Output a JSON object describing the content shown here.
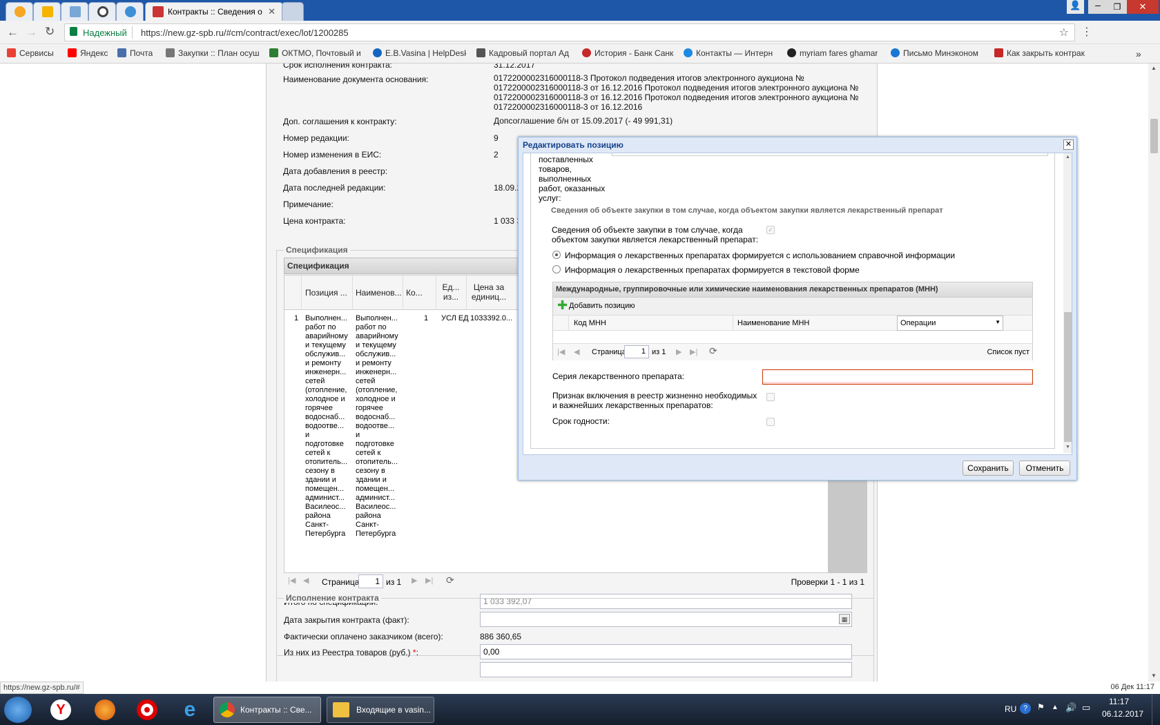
{
  "browser": {
    "active_tab_title": "Контракты :: Сведения о",
    "secure_label": "Надежный",
    "url": "https://new.gz-spb.ru/#cm/contract/exec/lot/1200285",
    "status_url": "https://new.gz-spb.ru/#",
    "status_date": "06 Дек 11:17"
  },
  "bookmarks": [
    {
      "label": "Сервисы",
      "color": "#e94235"
    },
    {
      "label": "Яндекс",
      "color": "#ff0000"
    },
    {
      "label": "Почта",
      "color": "#4a6ea9"
    },
    {
      "label": "Закупки :: План осуш",
      "color": "#777777"
    },
    {
      "label": "ОКТМО, Почтовый и",
      "color": "#2e7d32"
    },
    {
      "label": "E.B.Vasina | HelpDesk",
      "color": "#1565c0"
    },
    {
      "label": "Кадровый портал Ад",
      "color": "#555555"
    },
    {
      "label": "История - Банк Санк",
      "color": "#c62828"
    },
    {
      "label": "Контакты — Интерн",
      "color": "#1e88e5"
    },
    {
      "label": "myriam fares ghamar",
      "color": "#222222"
    },
    {
      "label": "Письмо Минэконом",
      "color": "#1976d2"
    },
    {
      "label": "Как закрыть контрак",
      "color": "#c62828"
    }
  ],
  "contract": {
    "row0_label": "Срок исполнения контракта:",
    "row0_value": "31.12.2017",
    "basis_label": "Наименование документа основания:",
    "basis_value": "0172200002316000118-3 Протокол подведения итогов электронного аукциона №\n0172200002316000118-3 от 16.12.2016 Протокол подведения итогов электронного аукциона №\n0172200002316000118-3 от 16.12.2016 Протокол подведения итогов электронного аукциона №\n0172200002316000118-3 от 16.12.2016",
    "addl_label": "Доп. соглашения к контракту:",
    "addl_value": "Допсоглашение б/н от 15.09.2017 (- 49 991,31)",
    "edition_label": "Номер редакции:",
    "edition_value": "9",
    "eis_label": "Номер изменения в ЕИС:",
    "eis_value": "2",
    "added_label": "Дата добавления в реестр:",
    "lastedit_label": "Дата последней редакции:",
    "lastedit_value": "18.09.2",
    "note_label": "Примечание:",
    "price_label": "Цена контракта:",
    "price_value": "1 033 3"
  },
  "spec": {
    "legend": "Спецификация",
    "panel_title": "Спецификация",
    "columns": [
      "Позиция ...",
      "Наименов...",
      "Ко...",
      "Ед... из...",
      "Цена за единиц..."
    ],
    "row_num": "1",
    "row_pos": "Выполнен...\nработ по\nаварийному\nи текущему\nобслужив...\nи ремонту\nинженерн...\nсетей\n(отопление,\nхолодное и\nгорячее\nводоснаб...\nводоотве...\nи\nподготовке\nсетей к\nотопитель...\nсезону в\nздании и\nпомещен...\nадминист...\nВасилеос...\nрайона\nСанкт-\nПетербурга",
    "row_name": "Выполнен...\nработ по\nаварийному\nи текущему\nобслужив...\nи ремонту\nинженерн...\nсетей\n(отопление,\nхолодное и\nгорячее\nводоснаб...\nводоотве...\nи\nподготовке\nсетей к\nотопитель...\nсезону в\nздании и\nпомещен...\nадминист...\nВасилеос...\nрайона\nСанкт-\nПетербурга",
    "row_qty": "1",
    "row_unit": "УСЛ ЕД",
    "row_price": "1033392.0...",
    "page_label": "Страница",
    "page_num": "1",
    "page_of": "из 1",
    "checks": "Проверки 1 - 1 из 1",
    "total_label": "Итого по спецификации:",
    "total_value": "1 033 392,07"
  },
  "execution": {
    "legend": "Исполнение контракта",
    "close_label": "Дата закрытия контракта (факт):",
    "paid_label": "Фактически оплачено заказчиком (всего):",
    "paid_value": "886 360,65",
    "registry_label": "Из них из Реестра товаров (руб.)",
    "registry_star": "*",
    "registry_colon": ":",
    "registry_value": "0,00"
  },
  "dialog": {
    "title": "Редактировать позицию",
    "wrapped_label": "поставленных\nтоваров,\nвыполненных\nработ, оказанных\nуслуг:",
    "section_title": "Сведения об объекте закупки в том случае, когда объектом закупки является лекарственный препарат",
    "drug_label": "Сведения об объекте закупки в том случае, когда\nобъектом закупки является лекарственный препарат:",
    "radio1": "Информация о лекарственных препаратах формируется с использованием справочной информации",
    "radio2": "Информация о лекарственных препаратах формируется в текстовой форме",
    "mnn_title": "Международные, группировочные или химические наименования лекарственных препаратов (МНН)",
    "add_label": "Добавить позицию",
    "col_code": "Код МНН",
    "col_name": "Наименование МНН",
    "col_ops": "Операции",
    "page_label": "Страница",
    "page_num": "1",
    "page_of": "из 1",
    "empty": "Список пуст",
    "series_label": "Серия лекарственного препарата:",
    "registry_label": "Признак включения в реестр жизненно необходимых\nи важнейших лекарственных препаратов:",
    "expiry_label": "Срок годности:",
    "save": "Сохранить",
    "cancel": "Отменить"
  },
  "taskbar": {
    "task1": "Контракты :: Све...",
    "task2": "Входящие в vasin...",
    "lang": "RU",
    "time": "11:17",
    "date": "06.12.2017"
  }
}
